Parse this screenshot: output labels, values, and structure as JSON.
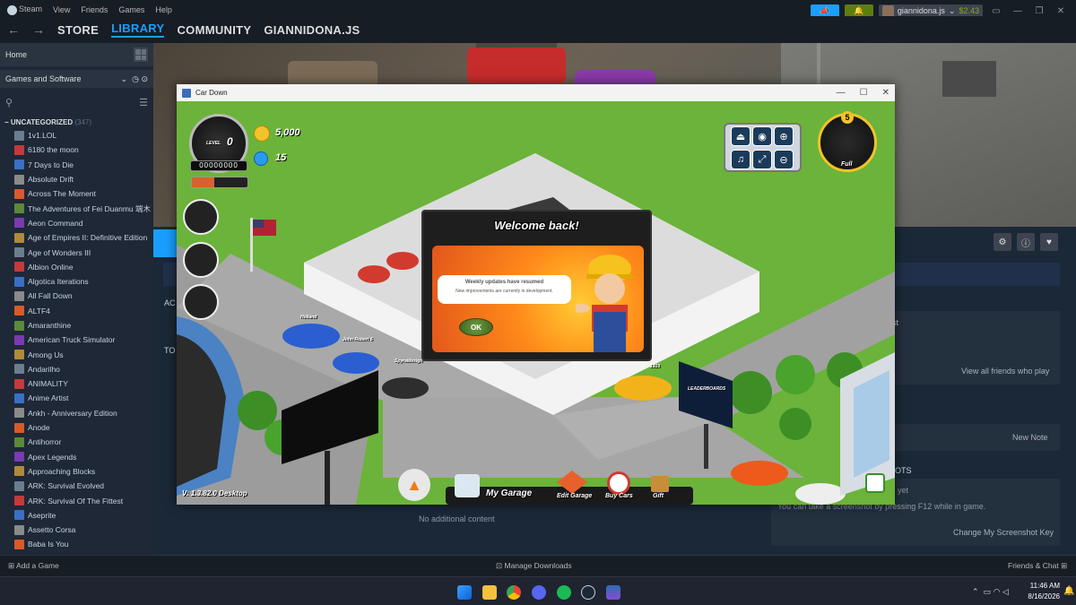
{
  "menubar": {
    "items": [
      "Steam",
      "View",
      "Friends",
      "Games",
      "Help"
    ]
  },
  "navbar": {
    "tabs": [
      "STORE",
      "LIBRARY",
      "COMMUNITY",
      "GIANNIDONA.JS"
    ],
    "active": "LIBRARY"
  },
  "account": {
    "name": "giannidona.js",
    "balance": "$2.43"
  },
  "sidebar": {
    "home_label": "Home",
    "filter_label": "Games and Software",
    "category": "UNCATEGORIZED",
    "category_count": "(347)",
    "games": [
      "1v1.LOL",
      "6180 the moon",
      "7 Days to Die",
      "Absolute Drift",
      "Across The Moment",
      "The Adventures of Fei Duanmu 端木",
      "Aeon Command",
      "Age of Empires II: Definitive Edition",
      "Age of Wonders III",
      "Albion Online",
      "Algotica Iterations",
      "All Fall Down",
      "ALTF4",
      "Amaranthine",
      "American Truck Simulator",
      "Among Us",
      "Andarilho",
      "ANIMALITY",
      "Anime Artist",
      "Ankh - Anniversary Edition",
      "Anode",
      "Antihorror",
      "Apex Legends",
      "Approaching Blocks",
      "ARK: Survival Evolved",
      "ARK: Survival Of The Fittest",
      "Aseprite",
      "Assetto Corsa",
      "Baba Is You"
    ]
  },
  "main": {
    "friends_heading": "nlist",
    "view_friends": "View all friends who play",
    "new_note": "New Note",
    "screenshots_heading": "OTS",
    "screenshots_none": "yet",
    "screenshot_hint": "You can take a screenshot by pressing F12 while in game.",
    "change_key": "Change My Screenshot Key",
    "no_content": "No additional content",
    "activity_label": "AC",
    "top_label": "TO"
  },
  "bottombar": {
    "add_game": "Add a Game",
    "downloads": "Manage Downloads",
    "friends_chat": "Friends & Chat"
  },
  "taskbar": {
    "time": "11:46 AM",
    "date": "8/16/2026"
  },
  "game": {
    "window_title": "Car Down",
    "coins": "5,000",
    "gems": "15",
    "level_label": "LEVEL",
    "level": "0",
    "xp": "00000000",
    "fuel_count": "5",
    "fuel_label": "Full",
    "dialog": {
      "title": "Welcome back!",
      "headline": "Weekly updates have resumed",
      "body": "New improvements are currently in development.",
      "ok": "OK"
    },
    "version": "V: 1.3.82.0  Desktop",
    "toolbar": [
      "My Garage",
      "Edit Garage",
      "Buy Cars",
      "Gift"
    ],
    "players": [
      "Holland",
      "John Robert 6",
      "Spyraldesign"
    ],
    "leaderboard_sign": "LEADERBOARDS",
    "tag_number": "1910"
  },
  "colors": {
    "accent": "#1a9fff",
    "steam_bg": "#1b2838",
    "grass": "#6bb33a",
    "dialog_orange": "#ff8a1a"
  }
}
